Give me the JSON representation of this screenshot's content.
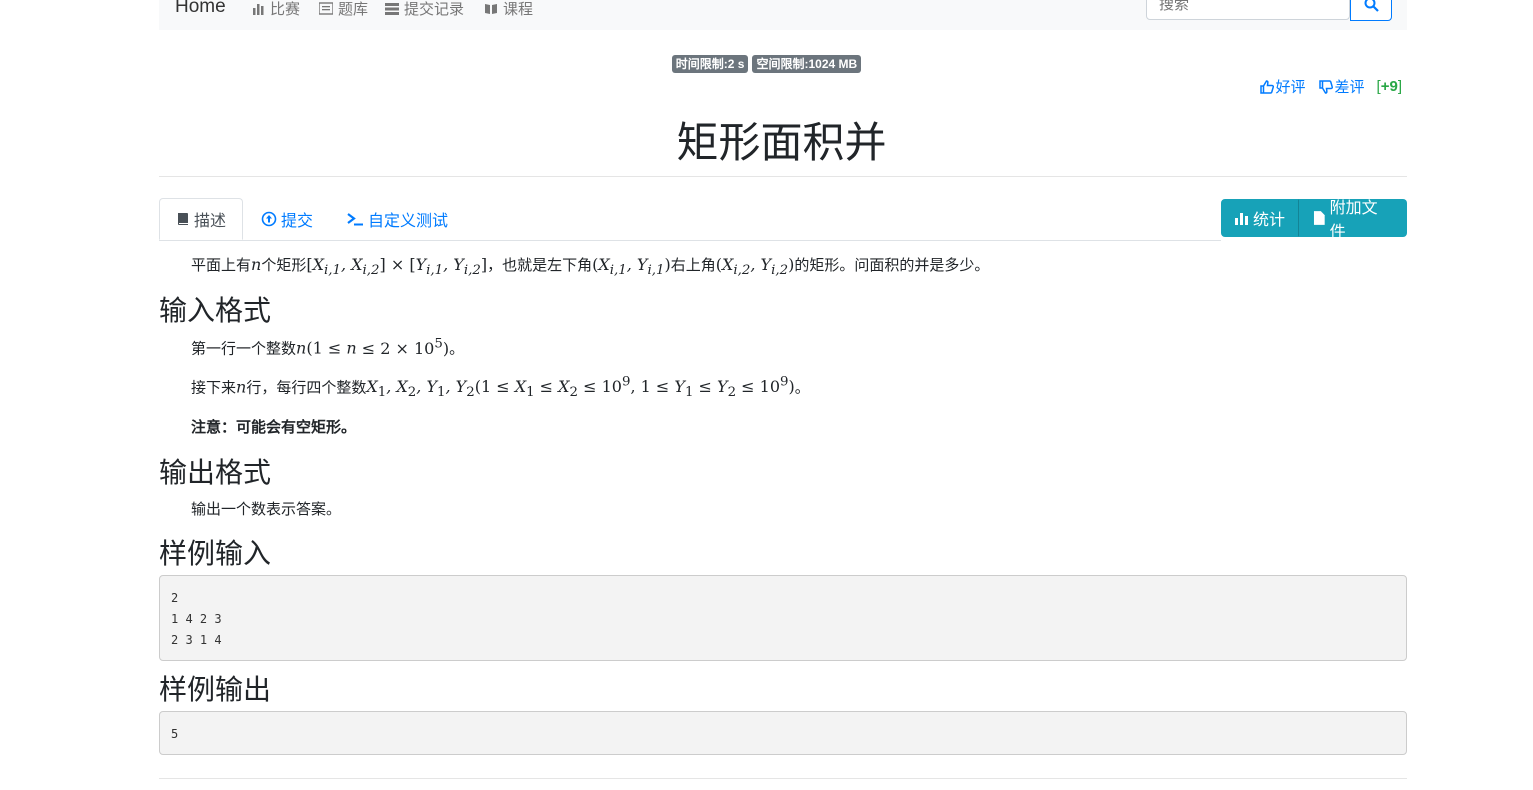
{
  "navbar": {
    "brand": "Home",
    "links": [
      {
        "icon": "bar-chart-icon",
        "label": "比赛"
      },
      {
        "icon": "list-icon",
        "label": "题库"
      },
      {
        "icon": "tasks-icon",
        "label": "提交记录"
      },
      {
        "icon": "book-icon",
        "label": "课程"
      }
    ],
    "search_placeholder": "搜索",
    "search_icon": "search-icon"
  },
  "limits": {
    "time": "时间限制:2 s",
    "memory": "空间限制:1024 MB"
  },
  "votes": {
    "up_label": "好评",
    "down_label": "差评",
    "score": "+9"
  },
  "title": "矩形面积并",
  "tabs": [
    {
      "icon": "book-icon",
      "label": "描述",
      "active": true
    },
    {
      "icon": "upload-icon",
      "label": "提交"
    },
    {
      "icon": "terminal-icon",
      "label": "自定义测试"
    }
  ],
  "buttons": {
    "stats": "统计",
    "attachments": "附加文件"
  },
  "description": {
    "p1_a": "平面上有",
    "p1_b": "个矩形",
    "p1_c": "，也就是左下角",
    "p1_d": "右上角",
    "p1_e": "的矩形。问面积的并是多少。"
  },
  "input_format": {
    "heading": "输入格式",
    "line1_a": "第一行一个整数",
    "line1_b": "。",
    "line2_a": "接下来",
    "line2_b": "行，每行四个整数",
    "line2_c": "。",
    "note": "注意：可能会有空矩形。"
  },
  "output_format": {
    "heading": "输出格式",
    "text": "输出一个数表示答案。"
  },
  "sample_input": {
    "heading": "样例输入",
    "lines": [
      "2",
      "1 4 2 3",
      "2 3 1 4"
    ]
  },
  "sample_output": {
    "heading": "样例输出",
    "lines": [
      "5"
    ]
  },
  "colors": {
    "primary": "#007bff",
    "info": "#17a2b8",
    "badge": "#6c757d",
    "success": "#28a745"
  }
}
